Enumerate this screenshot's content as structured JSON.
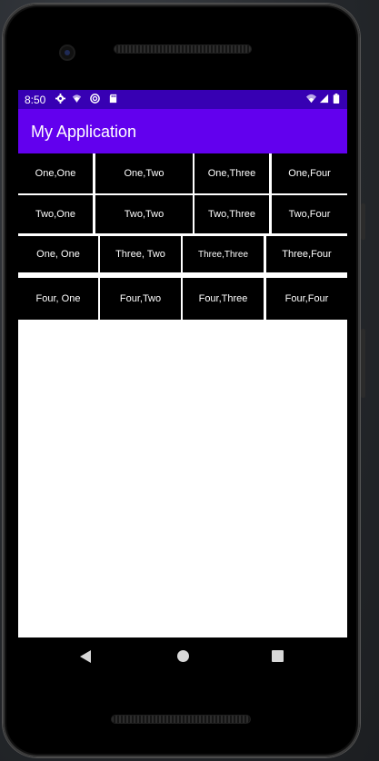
{
  "status_bar": {
    "time": "8:50",
    "left_icons": [
      "settings-icon",
      "wifi-calling-icon",
      "sync-icon",
      "sd-card-icon"
    ],
    "right_icons": [
      "wifi-icon",
      "signal-icon",
      "battery-icon"
    ]
  },
  "app_bar": {
    "title": "My Application"
  },
  "colors": {
    "status_bar": "#3700b3",
    "app_bar": "#6200ee",
    "cell_background": "#000000",
    "cell_text": "#ffffff",
    "screen_background": "#ffffff"
  },
  "grid": {
    "rows": [
      {
        "cells": [
          "One,One",
          "One,Two",
          "One,Three",
          "One,Four"
        ]
      },
      {
        "cells": [
          "Two,One",
          "Two,Two",
          "Two,Three",
          "Two,Four"
        ]
      },
      {
        "cells": [
          "One, One",
          "Three, Two",
          "Three,Three",
          "Three,Four"
        ]
      },
      {
        "cells": [
          "Four, One",
          "Four,Two",
          "Four,Three",
          "Four,Four"
        ]
      }
    ]
  },
  "nav_bar": {
    "buttons": [
      "back-icon",
      "home-icon",
      "recents-icon"
    ]
  }
}
